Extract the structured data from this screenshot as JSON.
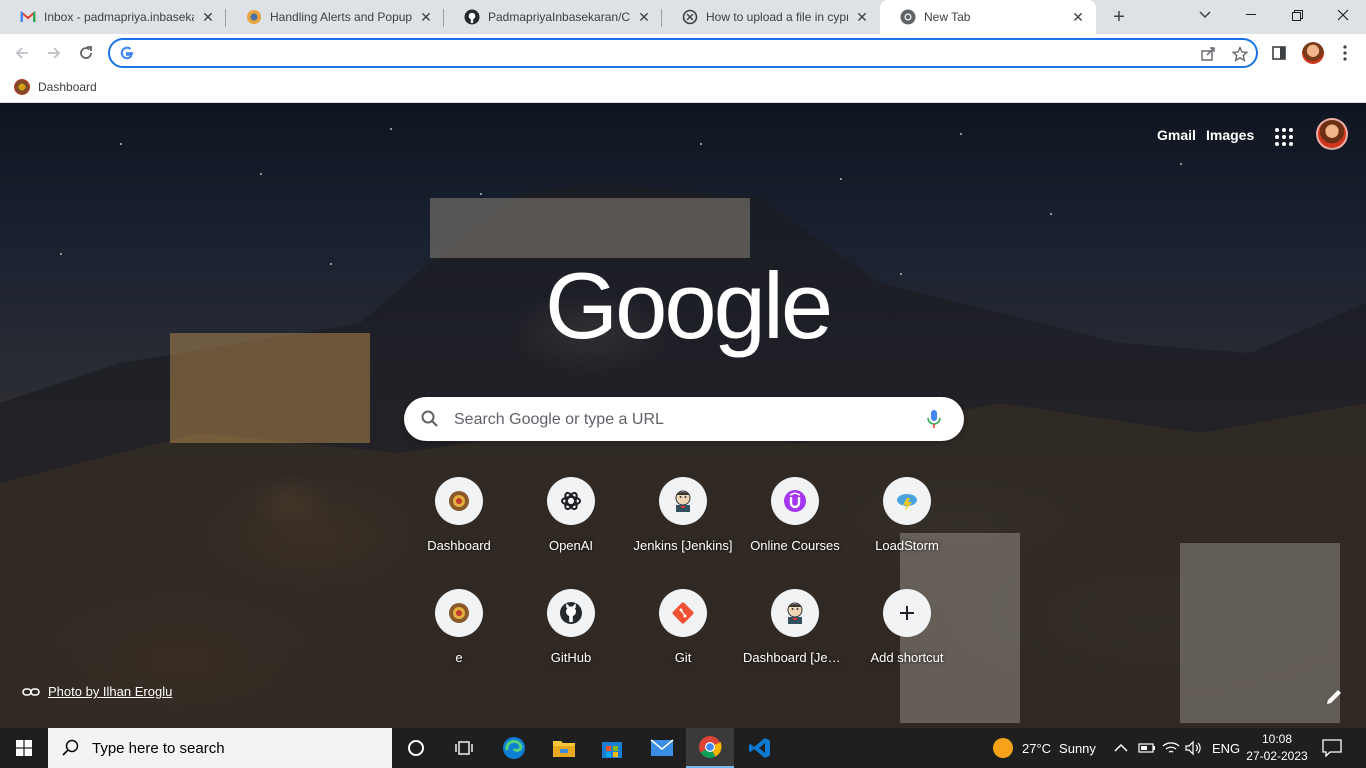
{
  "tabs": [
    {
      "title": "Inbox - padmapriya.inbasekaran",
      "icon": "gmail-icon"
    },
    {
      "title": "Handling Alerts and Popups in",
      "icon": "chrome-ext-icon"
    },
    {
      "title": "PadmapriyaInbasekaran/Cypress",
      "icon": "github-icon"
    },
    {
      "title": "How to upload a file in cypress",
      "icon": "cypress-icon"
    },
    {
      "title": "New Tab",
      "icon": "chrome-icon"
    }
  ],
  "omnibox": {
    "value": "",
    "placeholder": ""
  },
  "bookmarks": [
    {
      "label": "Dashboard"
    }
  ],
  "ntp": {
    "top_links": {
      "gmail": "Gmail",
      "images": "Images"
    },
    "logo_text": "Google",
    "search_placeholder": "Search Google or type a URL",
    "shortcuts": [
      {
        "label": "Dashboard",
        "icon": "dashboard-icon"
      },
      {
        "label": "OpenAI",
        "icon": "openai-icon"
      },
      {
        "label": "Jenkins [Jenkins]",
        "icon": "jenkins-icon"
      },
      {
        "label": "Online Courses",
        "icon": "udemy-icon"
      },
      {
        "label": "LoadStorm",
        "icon": "loadstorm-icon"
      },
      {
        "label": "e",
        "icon": "dashboard-icon"
      },
      {
        "label": "GitHub",
        "icon": "github-icon"
      },
      {
        "label": "Git",
        "icon": "git-icon"
      },
      {
        "label": "Dashboard [Jenkins]",
        "icon": "jenkins-icon"
      },
      {
        "label": "Add shortcut",
        "icon": "plus-icon"
      }
    ],
    "photo_credit": "Photo by Ilhan Eroglu"
  },
  "taskbar": {
    "search_placeholder": "Type here to search",
    "weather": {
      "temp": "27°C",
      "condition": "Sunny"
    },
    "language": "ENG",
    "time": "10:08",
    "date": "27-02-2023"
  },
  "colors": {
    "accent": "#1a73e8",
    "tabstrip": "#dee1e6",
    "taskbar": "#1f1f1f"
  }
}
